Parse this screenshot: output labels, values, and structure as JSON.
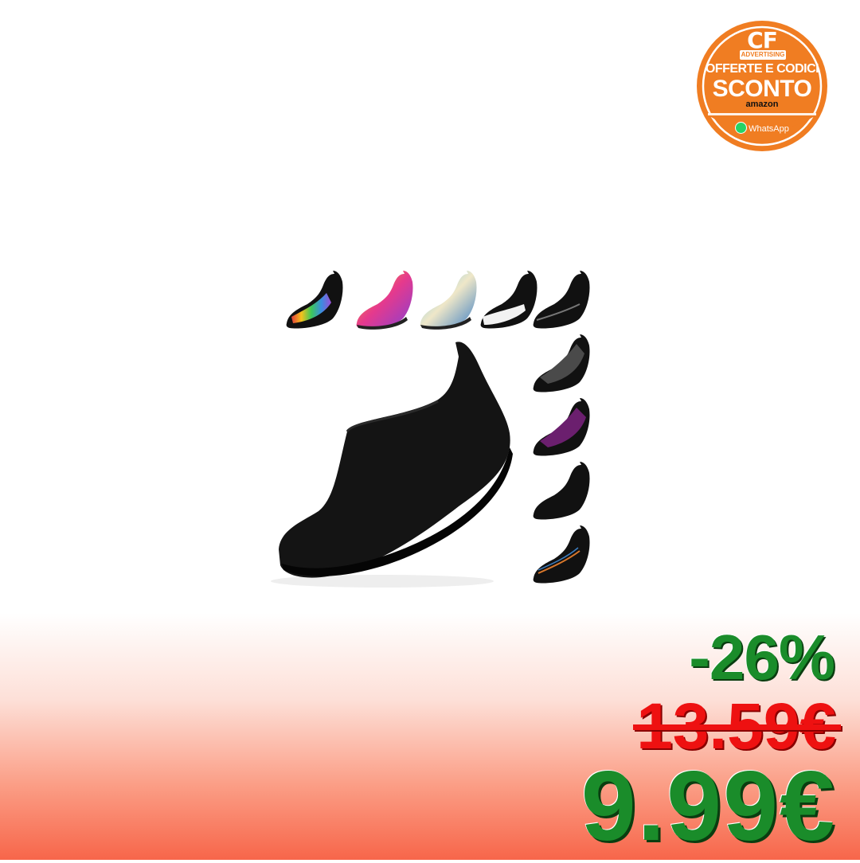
{
  "badge": {
    "brand": "CF",
    "sub": "ADVERTISING",
    "line1": "OFFERTE E CODICI",
    "line2": "SCONTO",
    "line3": "amazon",
    "whatsapp": "WhatsApp",
    "colors": {
      "orange": "#f07d22",
      "white": "#ffffff"
    }
  },
  "product": {
    "main_color": "#111111",
    "variants": [
      {
        "color": "#1b1b1b",
        "accent": "rainbow"
      },
      {
        "color": "#e33a8d",
        "accent": "orange"
      },
      {
        "color": "#5bb4e0",
        "accent": "cream"
      },
      {
        "color": "#111111",
        "accent": "white"
      },
      {
        "color": "#111111",
        "accent": "grey-line"
      },
      {
        "color": "#111111",
        "accent": "grey-mesh"
      },
      {
        "color": "#111111",
        "accent": "purple"
      },
      {
        "color": "#111111",
        "accent": "black"
      },
      {
        "color": "#111111",
        "accent": "stripes"
      }
    ]
  },
  "price": {
    "discount": "-26%",
    "old_price": "13.59€",
    "new_price": "9.99€",
    "colors": {
      "green": "#1a8c2a",
      "red": "#ee1111"
    }
  }
}
